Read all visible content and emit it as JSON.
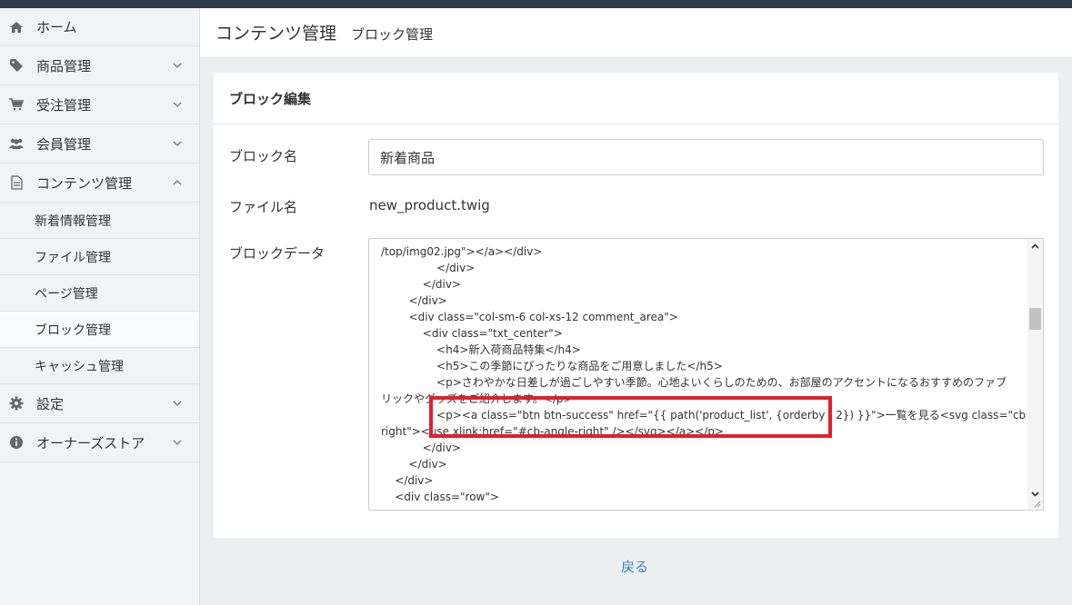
{
  "header": {
    "title": "コンテンツ管理",
    "subtitle": "ブロック管理"
  },
  "sidebar": {
    "items": [
      {
        "label": "ホーム",
        "icon": "home-icon"
      },
      {
        "label": "商品管理",
        "icon": "tag-icon"
      },
      {
        "label": "受注管理",
        "icon": "cart-icon"
      },
      {
        "label": "会員管理",
        "icon": "users-icon"
      },
      {
        "label": "コンテンツ管理",
        "icon": "document-icon"
      },
      {
        "label": "設定",
        "icon": "gear-icon"
      },
      {
        "label": "オーナーズストア",
        "icon": "info-icon"
      }
    ],
    "subitems": [
      "新着情報管理",
      "ファイル管理",
      "ページ管理",
      "ブロック管理",
      "キャッシュ管理"
    ]
  },
  "card": {
    "title": "ブロック編集",
    "block_name_label": "ブロック名",
    "block_name_value": "新着商品",
    "file_name_label": "ファイル名",
    "file_name_value": "new_product.twig",
    "block_data_label": "ブロックデータ",
    "code_lines": [
      "/top/img02.jpg\"></a></div>",
      "                </div>",
      "            </div>",
      "        </div>",
      "        <div class=\"col-sm-6 col-xs-12 comment_area\">",
      "            <div class=\"txt_center\">",
      "                <h4>新入荷商品特集</h4>",
      "                <h5>この季節にぴったりな商品をご用意しました</h5>",
      "                <p>さわやかな日差しが過ごしやすい季節。心地よいくらしのための、お部屋のアクセントになるおすすめのファブ",
      "リックやグッズをご紹介します。</p>",
      "                <p><a class=\"btn btn-success\" href=\"{{ path('product_list', {orderby : 2}) }}\">一覧を見る<svg class=\"cb cb-angle-",
      "right\"><use xlink:href=\"#cb-angle-right\" /></svg></a></p>",
      "            </div>",
      "        </div>",
      "    </div>",
      "    <div class=\"row\">"
    ]
  },
  "footer": {
    "back_label": "戻る"
  },
  "colors": {
    "accent": "#3a7fc2",
    "highlight": "#e0202b",
    "topbar": "#2e3b47"
  }
}
